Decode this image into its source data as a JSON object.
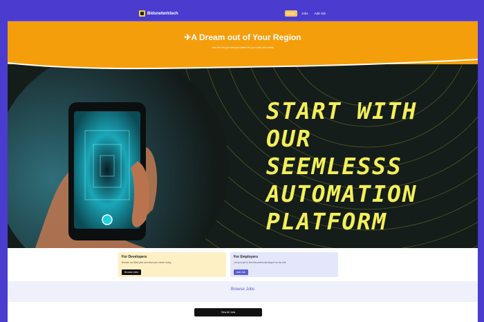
{
  "nav": {
    "brand": "Bidsnetwrktech",
    "links": [
      "Home",
      "Jobs",
      "Add Job"
    ]
  },
  "hero": {
    "title": "✈A Dream out of Your Region",
    "subtitle": "Find the best job because better fits your skills and needs"
  },
  "banner": {
    "headline_lines": [
      "START WITH",
      "OUR",
      "SEEMLESSS",
      "AUTOMATION",
      "PLATFORM"
    ]
  },
  "cards": {
    "developers": {
      "title": "For Developers",
      "text": "Browse our Best jobs and start your career today",
      "button": "Browse Jobs"
    },
    "employers": {
      "title": "For Employers",
      "text": "Let your job to find the perfect developer for the role",
      "button": "Add Job"
    }
  },
  "browse": {
    "title": "Browse Jobs"
  },
  "view_all": {
    "label": "View All Jobs"
  },
  "colors": {
    "page_bg": "#4a3ccf",
    "hero_orange": "#f59e0b",
    "headline_yellow": "#f2ef5a",
    "banner_dark": "#1a2420"
  }
}
